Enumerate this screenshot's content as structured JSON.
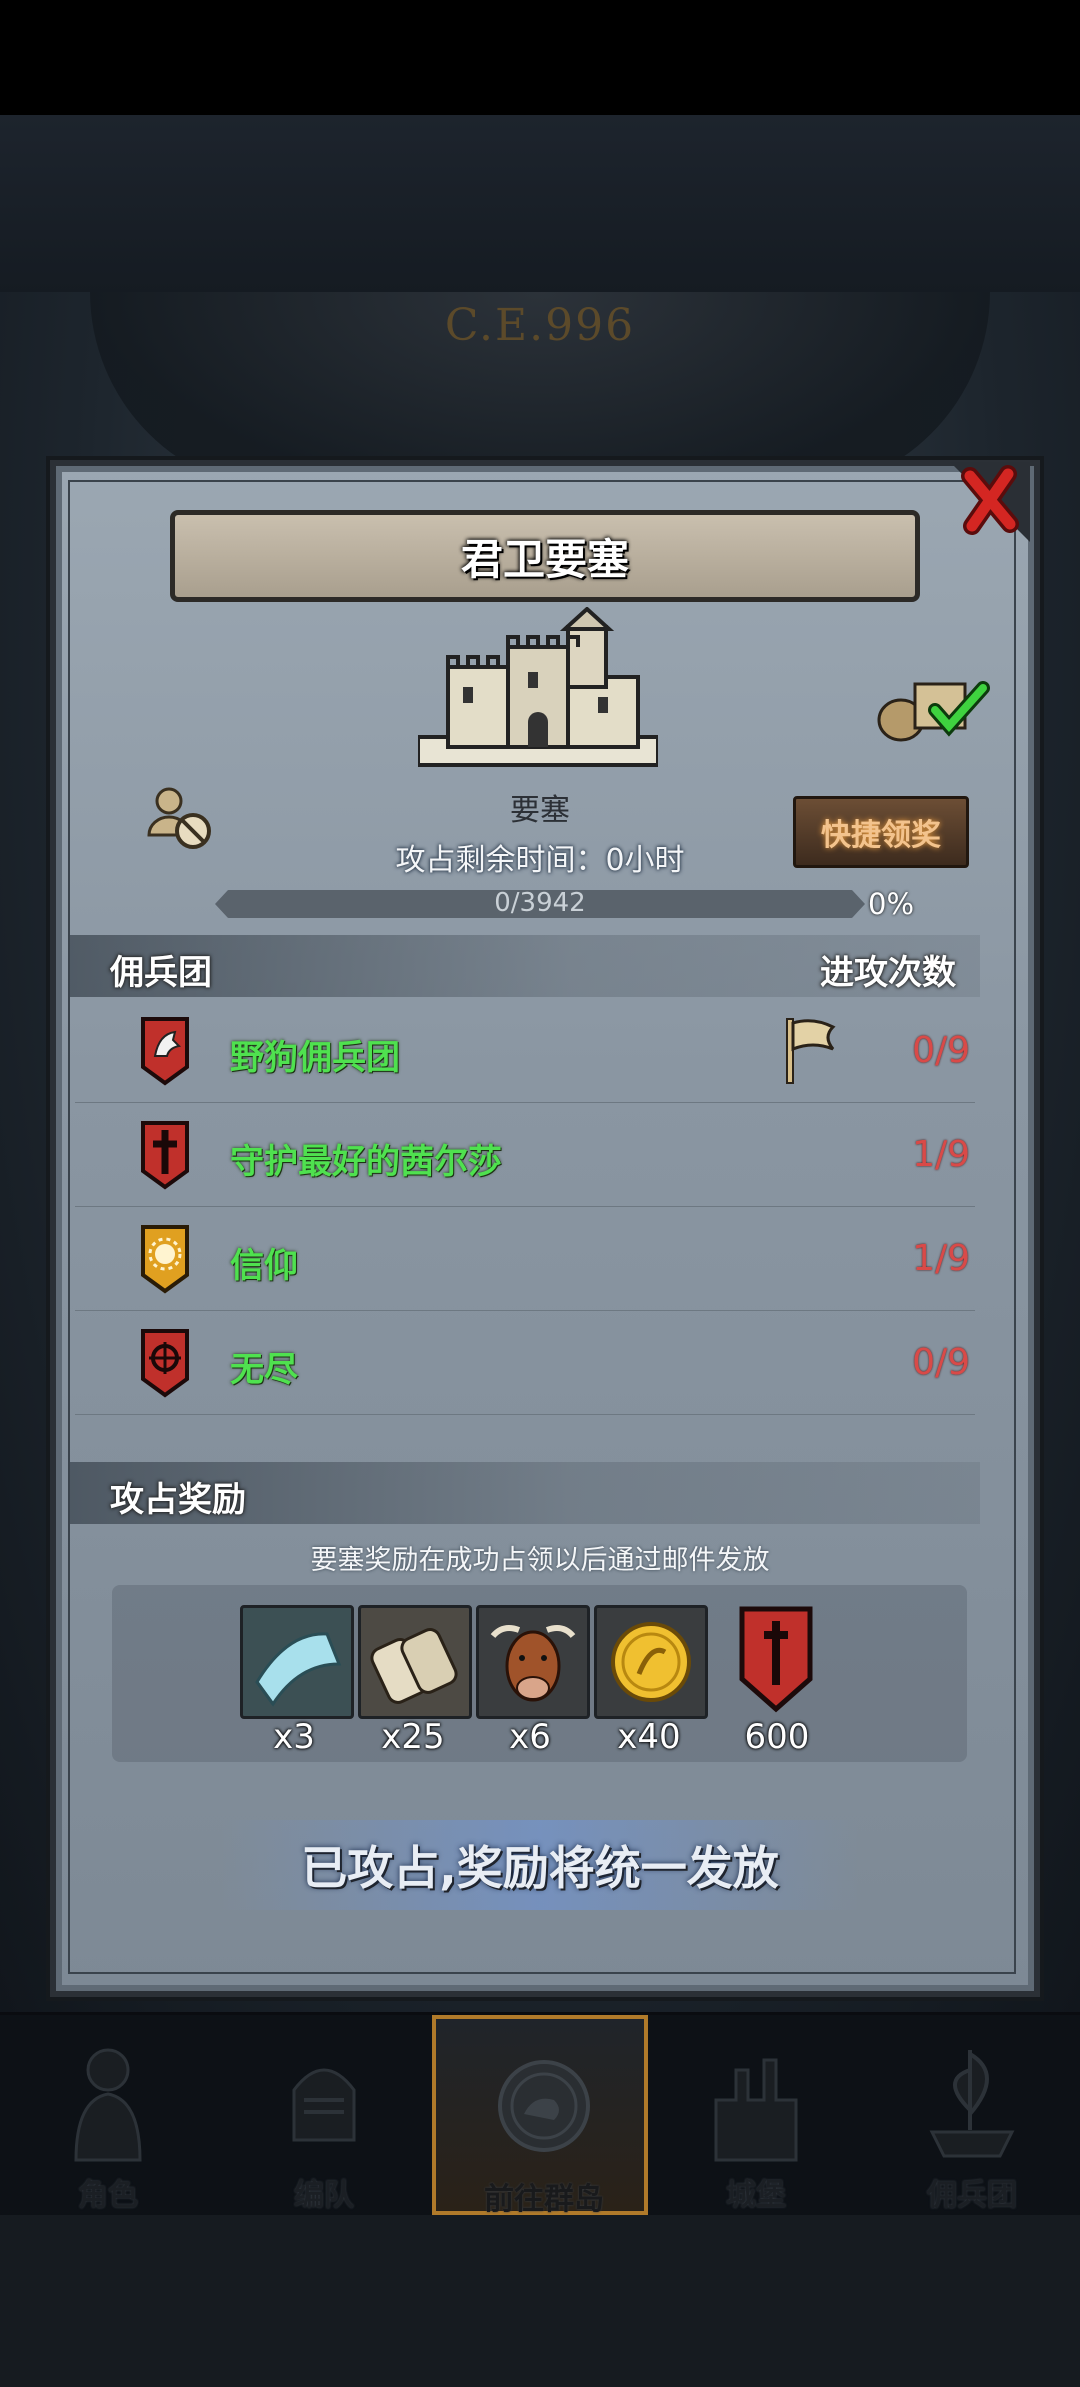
{
  "era": "C.E.996",
  "dialog": {
    "title": "君卫要塞",
    "castle_label": "要塞",
    "quick_claim_label": "快捷领奖",
    "remaining_time": "攻占剩余时间：0小时",
    "progress": {
      "text": "0/3942",
      "percent_text": "0%",
      "fraction": 0
    },
    "mercenary_section": {
      "title": "佣兵团",
      "attack_count_header": "进攻次数",
      "rows": [
        {
          "name": "野狗佣兵团",
          "count": "0/9",
          "icon": "wolf-banner-icon",
          "color": "#c0302b"
        },
        {
          "name": "守护最好的茜尔莎",
          "count": "1/9",
          "icon": "cross-banner-icon",
          "color": "#c0302b"
        },
        {
          "name": "信仰",
          "count": "1/9",
          "icon": "sun-banner-icon",
          "color": "#e0a020"
        },
        {
          "name": "无尽",
          "count": "0/9",
          "icon": "target-banner-icon",
          "color": "#c0302b"
        }
      ]
    },
    "reward_section": {
      "title": "攻占奖励",
      "note": "要塞奖励在成功占领以后通过邮件发放",
      "items": [
        {
          "icon": "cloth-icon",
          "qty": "x3"
        },
        {
          "icon": "scroll-icon",
          "qty": "x25"
        },
        {
          "icon": "cattle-icon",
          "qty": "x6"
        },
        {
          "icon": "gold-coin-icon",
          "qty": "x40"
        },
        {
          "icon": "sword-banner-icon",
          "qty": "600"
        }
      ]
    },
    "status": "已攻占,奖励将统一发放"
  },
  "nav": [
    {
      "label": "角色",
      "icon": "knight-icon"
    },
    {
      "label": "编队",
      "icon": "helmet-icon"
    },
    {
      "label": "前往群岛",
      "icon": "compass-icon",
      "active": true
    },
    {
      "label": "城堡",
      "icon": "castle-icon"
    },
    {
      "label": "佣兵团",
      "icon": "ship-icon"
    }
  ]
}
